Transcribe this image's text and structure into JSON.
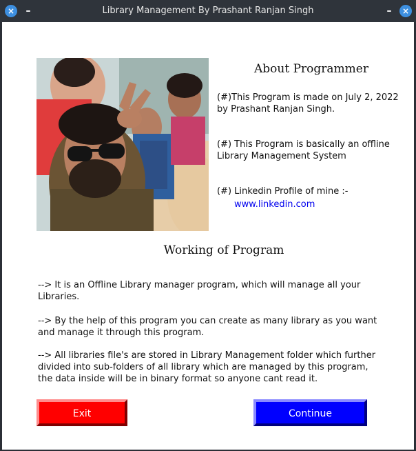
{
  "window": {
    "title": "Library Management By Prashant Ranjan Singh",
    "close_icon": "×",
    "minimize_icon": "–"
  },
  "about": {
    "title": "About Programmer",
    "para1": "(#)This Program is made on July 2, 2022 by Prashant Ranjan Singh.",
    "para2": "(#) This Program is basically an offline Library Management System",
    "para3": "(#) Linkedin Profile of mine :-",
    "link": "www.linkedin.com"
  },
  "working": {
    "title": "Working of Program",
    "para1": "--> It is an Offline Library manager program, which will manage all your Libraries.",
    "para2": "--> By the help of this program you can create as many library as you want and manage it through this program.",
    "para3": "--> All libraries file's are stored in Library Management folder which further divided into sub-folders of all library which are managed by this program, the data inside will be in binary format so anyone cant read it."
  },
  "buttons": {
    "exit": "Exit",
    "continue": "Continue"
  },
  "colors": {
    "exit_button": "#ff0000",
    "continue_button": "#0000ff",
    "link": "#0000ee",
    "titlebar_icon": "#3d8fe0"
  },
  "icons": {
    "left_close": "close-icon",
    "left_minimize": "minimize-icon",
    "right_close": "close-icon",
    "right_minimize": "minimize-icon"
  }
}
